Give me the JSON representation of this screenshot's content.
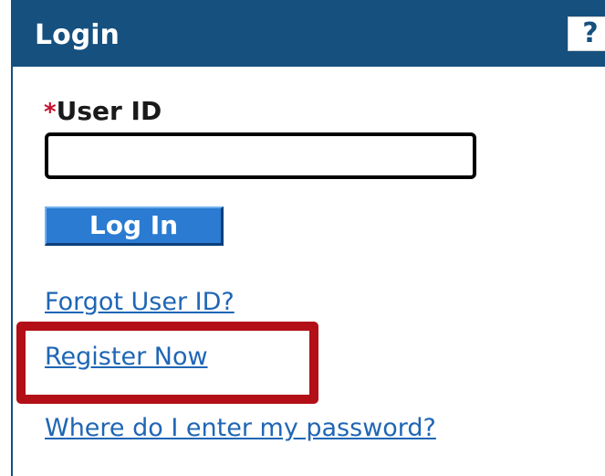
{
  "header": {
    "title": "Login",
    "help_label": "?"
  },
  "form": {
    "required_marker": "*",
    "userid_label": "User ID",
    "userid_value": "",
    "login_label": "Log In"
  },
  "links": {
    "forgot": "Forgot User ID?",
    "register": "Register Now",
    "password": "Where do I enter my password?"
  },
  "colors": {
    "header_bg": "#15507f",
    "button_bg": "#2a7bd1",
    "link": "#1f66b5",
    "required": "#c8102e",
    "highlight": "#b20f16"
  }
}
